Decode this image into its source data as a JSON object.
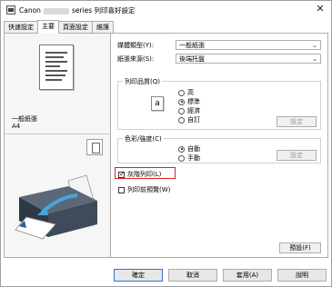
{
  "window": {
    "title_left": "Canon",
    "title_right": "series 列印喜好設定",
    "close_glyph": "✕"
  },
  "tabs": [
    {
      "label": "快速設定"
    },
    {
      "label": "主要"
    },
    {
      "label": "頁面設定"
    },
    {
      "label": "維護"
    }
  ],
  "preview": {
    "media_name": "一般紙張",
    "paper_size": "A4"
  },
  "main": {
    "media_type_label": "媒體類型(Y):",
    "media_type_value": "一般紙張",
    "paper_source_label": "紙張來源(S):",
    "paper_source_value": "後端托盤",
    "print_quality_label": "列印品質(Q)",
    "quality_options": [
      {
        "label": "高",
        "checked": false
      },
      {
        "label": "標準",
        "checked": true
      },
      {
        "label": "經濟",
        "checked": false
      },
      {
        "label": "自訂",
        "checked": false
      }
    ],
    "quality_icon_glyph": "a",
    "quality_settings_button": "設定",
    "color_intensity_label": "色彩/強度(C)",
    "color_options": [
      {
        "label": "自動",
        "checked": true
      },
      {
        "label": "手動",
        "checked": false
      }
    ],
    "color_settings_button": "設定",
    "grayscale_label": "灰階列印(L)",
    "grayscale_checked": true,
    "preview_before_print_label": "列印前預覽(W)",
    "preview_before_print_checked": false,
    "defaults_button": "預設(F)"
  },
  "footer": {
    "ok": "確定",
    "cancel": "取消",
    "apply": "套用(A)",
    "help": "說明"
  },
  "colors": {
    "highlight": "#e02020",
    "printer_body": "#3f4b5a",
    "printer_accent": "#4aa3df"
  }
}
